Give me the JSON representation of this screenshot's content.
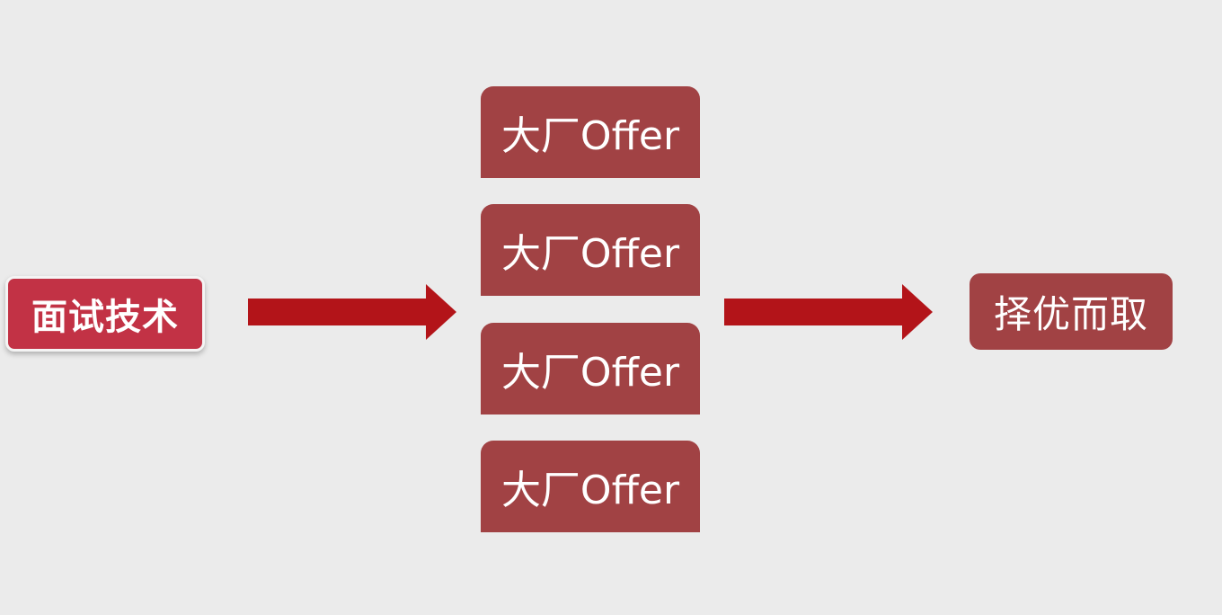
{
  "diagram": {
    "source": {
      "label": "面试技术"
    },
    "offers": [
      {
        "label": "大厂Offer"
      },
      {
        "label": "大厂Offer"
      },
      {
        "label": "大厂Offer"
      },
      {
        "label": "大厂Offer"
      }
    ],
    "result": {
      "label": "择优而取"
    }
  },
  "colors": {
    "background": "#ebebeb",
    "source_fill": "#c23245",
    "box_fill": "#a14244",
    "arrow_fill": "#b31419",
    "text": "#ffffff"
  }
}
